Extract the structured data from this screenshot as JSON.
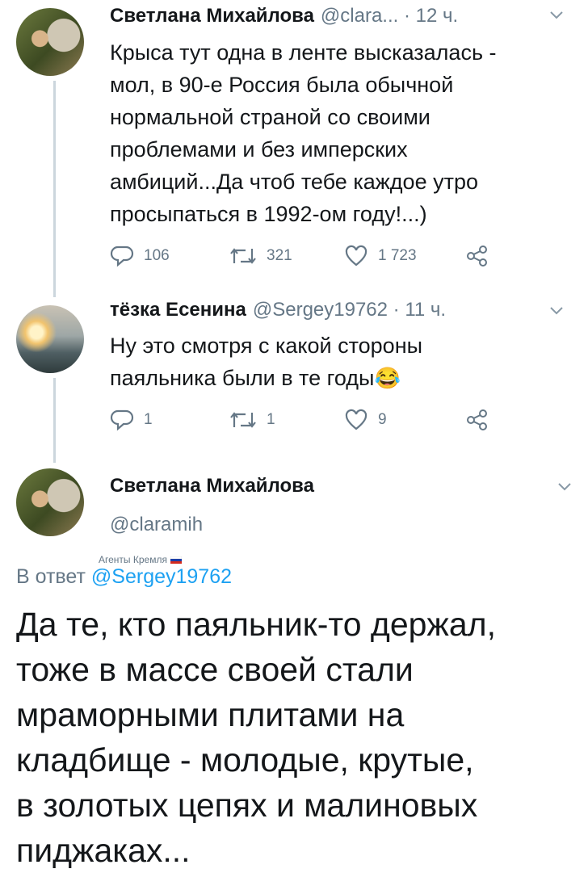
{
  "tweets": [
    {
      "name": "Светлана Михайлова",
      "handle_time": "@clara... · 12 ч.",
      "text_lines": [
        "Крыса тут одна в ленте высказалась -",
        "мол, в 90-е Россия была обычной",
        "нормальной страной со своими",
        "проблемами и без имперских",
        "амбиций...Да чтоб тебе каждое утро",
        "просыпаться в 1992-ом году!...)"
      ],
      "replies": "106",
      "retweets": "321",
      "likes": "1 723"
    },
    {
      "name": "тёзка Есенина",
      "handle_time": "@Sergey19762 · 11 ч.",
      "text_lines": [
        "Ну это смотря с какой стороны",
        "паяльника были в те годы"
      ],
      "emoji": "😂",
      "replies": "1",
      "retweets": "1",
      "likes": "9"
    }
  ],
  "main_tweet": {
    "name": "Светлана Михайлова",
    "handle": "@claramih",
    "badge": "Агенты Кремля",
    "reply_to_prefix": "В ответ",
    "reply_to_handle": "@Sergey19762",
    "text_lines": [
      "Да те, кто паяльник-то держал,",
      "тоже в массе своей стали",
      "мраморными плитами на",
      "кладбище - молодые, крутые,",
      "в золотых цепях и малиновых",
      "пиджаках..."
    ]
  },
  "colors": {
    "text": "#14171a",
    "secondary": "#657786",
    "link": "#1da1f2",
    "thread_line": "#ccd6dd"
  },
  "icons": [
    "reply-icon",
    "retweet-icon",
    "like-icon",
    "share-icon",
    "chevron-down-icon",
    "flag-ru-icon"
  ]
}
